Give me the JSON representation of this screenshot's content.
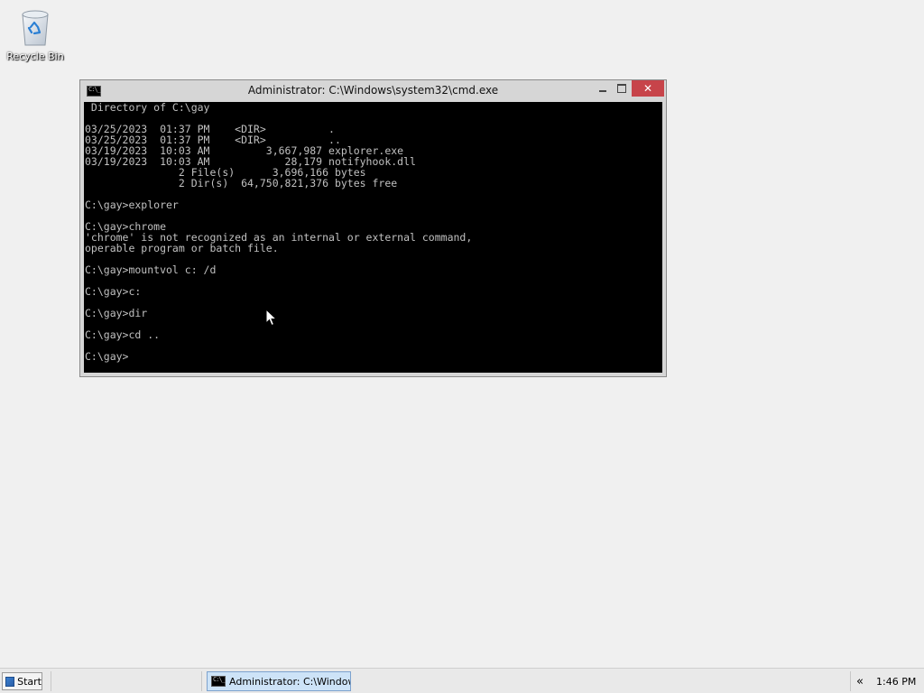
{
  "desktop": {
    "icons": [
      {
        "label": "Recycle Bin",
        "icon": "recycle-bin-icon"
      }
    ]
  },
  "window": {
    "title": "Administrator: C:\\Windows\\system32\\cmd.exe",
    "icon": "cmd-icon",
    "icon_text": "C:\\_",
    "buttons": {
      "minimize": "minimize",
      "maximize": "maximize",
      "close": "close"
    },
    "console_lines": [
      " Directory of C:\\gay",
      "",
      "03/25/2023  01:37 PM    <DIR>          .",
      "03/25/2023  01:37 PM    <DIR>          ..",
      "03/19/2023  10:03 AM         3,667,987 explorer.exe",
      "03/19/2023  10:03 AM            28,179 notifyhook.dll",
      "               2 File(s)      3,696,166 bytes",
      "               2 Dir(s)  64,750,821,376 bytes free",
      "",
      "C:\\gay>explorer",
      "",
      "C:\\gay>chrome",
      "'chrome' is not recognized as an internal or external command,",
      "operable program or batch file.",
      "",
      "C:\\gay>mountvol c: /d",
      "",
      "C:\\gay>c:",
      "",
      "C:\\gay>dir",
      "",
      "C:\\gay>cd ..",
      "",
      "C:\\gay>"
    ],
    "colors": {
      "background": "#000000",
      "text": "#c0c0c0"
    }
  },
  "taskbar": {
    "start_label": "Start",
    "tasks": [
      {
        "label": "Administrator: C:\\Window...",
        "icon": "cmd-icon",
        "icon_text": "C:\\_",
        "active": true
      }
    ],
    "tray": {
      "chevron": "«",
      "clock": "1:46 PM"
    }
  }
}
